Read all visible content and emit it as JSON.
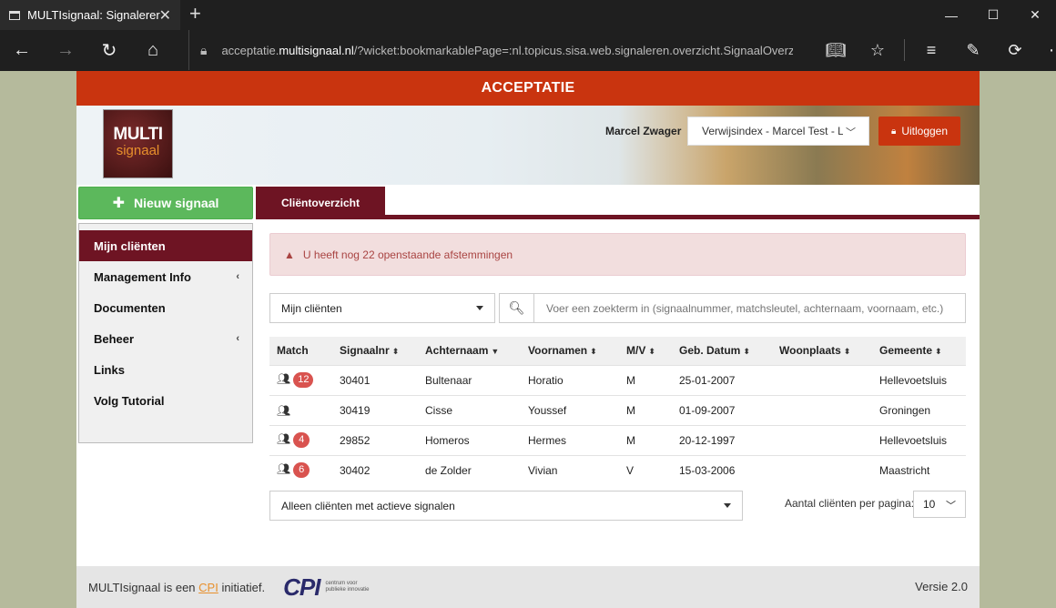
{
  "browser": {
    "tab_title": "MULTIsignaal: Signalerer",
    "url_prefix": "acceptatie.",
    "url_domain": "multisignaal.nl",
    "url_path": "/?wicket:bookmarkablePage=:nl.topicus.sisa.web.signaleren.overzicht.SignaalOverzicht"
  },
  "env_label": "ACCEPTATIE",
  "header": {
    "logo_line1": "MULTI",
    "logo_line2": "signaal",
    "user_name": "Marcel Zwager",
    "org_select": "Verwijsindex - Marcel Test - Lokaal",
    "logout_label": "Uitloggen"
  },
  "new_signal_label": "Nieuw signaal",
  "tabs": [
    {
      "label": "Cliëntoverzicht"
    }
  ],
  "sidebar": {
    "items": [
      {
        "label": "Mijn cliënten"
      },
      {
        "label": "Management Info"
      },
      {
        "label": "Documenten"
      },
      {
        "label": "Beheer"
      },
      {
        "label": "Links"
      },
      {
        "label": "Volg Tutorial"
      }
    ]
  },
  "alert": {
    "text": "U heeft nog 22 openstaande afstemmingen"
  },
  "filter": {
    "selected": "Mijn cliënten"
  },
  "search": {
    "placeholder": "Voer een zoekterm in (signaalnummer, matchsleutel, achternaam, voornaam, etc.)"
  },
  "table": {
    "columns": [
      "Match",
      "Signaalnr",
      "Achternaam",
      "Voornamen",
      "M/V",
      "Geb. Datum",
      "Woonplaats",
      "Gemeente"
    ],
    "rows": [
      {
        "match": "12",
        "signaalnr": "30401",
        "achternaam": "Bultenaar",
        "voornamen": "Horatio",
        "mv": "M",
        "geb": "25-01-2007",
        "woonplaats": "",
        "gemeente": "Hellevoetsluis"
      },
      {
        "match": "",
        "signaalnr": "30419",
        "achternaam": "Cisse",
        "voornamen": "Youssef",
        "mv": "M",
        "geb": "01-09-2007",
        "woonplaats": "",
        "gemeente": "Groningen"
      },
      {
        "match": "4",
        "signaalnr": "29852",
        "achternaam": "Homeros",
        "voornamen": "Hermes",
        "mv": "M",
        "geb": "20-12-1997",
        "woonplaats": "",
        "gemeente": "Hellevoetsluis"
      },
      {
        "match": "6",
        "signaalnr": "30402",
        "achternaam": "de Zolder",
        "voornamen": "Vivian",
        "mv": "V",
        "geb": "15-03-2006",
        "woonplaats": "",
        "gemeente": "Maastricht"
      }
    ]
  },
  "active_filter": {
    "selected": "Alleen cliënten met actieve signalen"
  },
  "pagination": {
    "label": "Aantal cliënten per pagina:",
    "value": "10"
  },
  "footer": {
    "text_before": "MULTIsignaal is een ",
    "link": "CPI",
    "text_after": " initiatief.",
    "cpi_logo": "CPI",
    "cpi_sub": "centrum voor publieke innovatie",
    "version": "Versie 2.0"
  },
  "colors": {
    "accent": "#6e1423",
    "env": "#c9340f",
    "success": "#5cb85c",
    "badge": "#d9534f"
  }
}
